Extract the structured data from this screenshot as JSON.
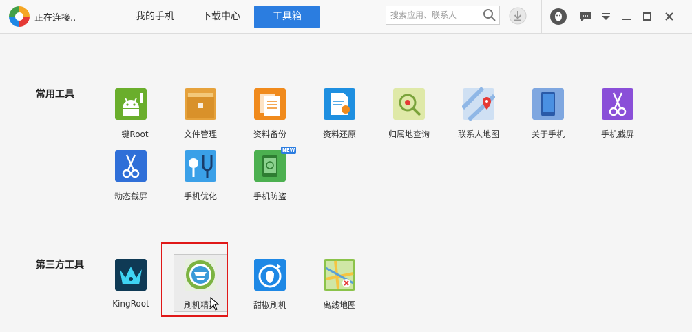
{
  "header": {
    "status": "正在连接..",
    "tabs": [
      {
        "label": "我的手机",
        "active": false
      },
      {
        "label": "下载中心",
        "active": false
      },
      {
        "label": "工具箱",
        "active": true
      }
    ],
    "search_placeholder": "搜索应用、联系人",
    "accent": "#2b7de0"
  },
  "sections": {
    "common": {
      "title": "常用工具",
      "tools": [
        {
          "label": "一键Root",
          "icon": "android-root-icon",
          "color": "#6aae2c"
        },
        {
          "label": "文件管理",
          "icon": "folder-icon",
          "color": "#e6a23c"
        },
        {
          "label": "资料备份",
          "icon": "backup-docs-icon",
          "color": "#f08a1c"
        },
        {
          "label": "资料还原",
          "icon": "restore-docs-icon",
          "color": "#1e8fe0"
        },
        {
          "label": "归属地查询",
          "icon": "location-search-icon",
          "color": "#c5d98a"
        },
        {
          "label": "联系人地图",
          "icon": "contact-map-icon",
          "color": "#8fb7e6"
        },
        {
          "label": "关于手机",
          "icon": "phone-info-icon",
          "color": "#4a90e2"
        },
        {
          "label": "手机截屏",
          "icon": "scissors-icon",
          "color": "#8a4fd8"
        },
        {
          "label": "动态截屏",
          "icon": "dynamic-scissors-icon",
          "color": "#2f6fd8"
        },
        {
          "label": "手机优化",
          "icon": "stethoscope-icon",
          "color": "#3aa0e8"
        },
        {
          "label": "手机防盗",
          "icon": "anti-theft-icon",
          "color": "#4cb050",
          "badge": "NEW"
        }
      ]
    },
    "third": {
      "title": "第三方工具",
      "tools": [
        {
          "label": "KingRoot",
          "icon": "kingroot-icon",
          "color": "#0f3a55"
        },
        {
          "label": "刷机精灵",
          "icon": "shuaji-icon",
          "color": "#7cb342"
        },
        {
          "label": "甜椒刷机",
          "icon": "tianjiao-icon",
          "color": "#1e88e5"
        },
        {
          "label": "离线地图",
          "icon": "offline-map-icon",
          "color": "#8bc34a"
        }
      ]
    }
  }
}
